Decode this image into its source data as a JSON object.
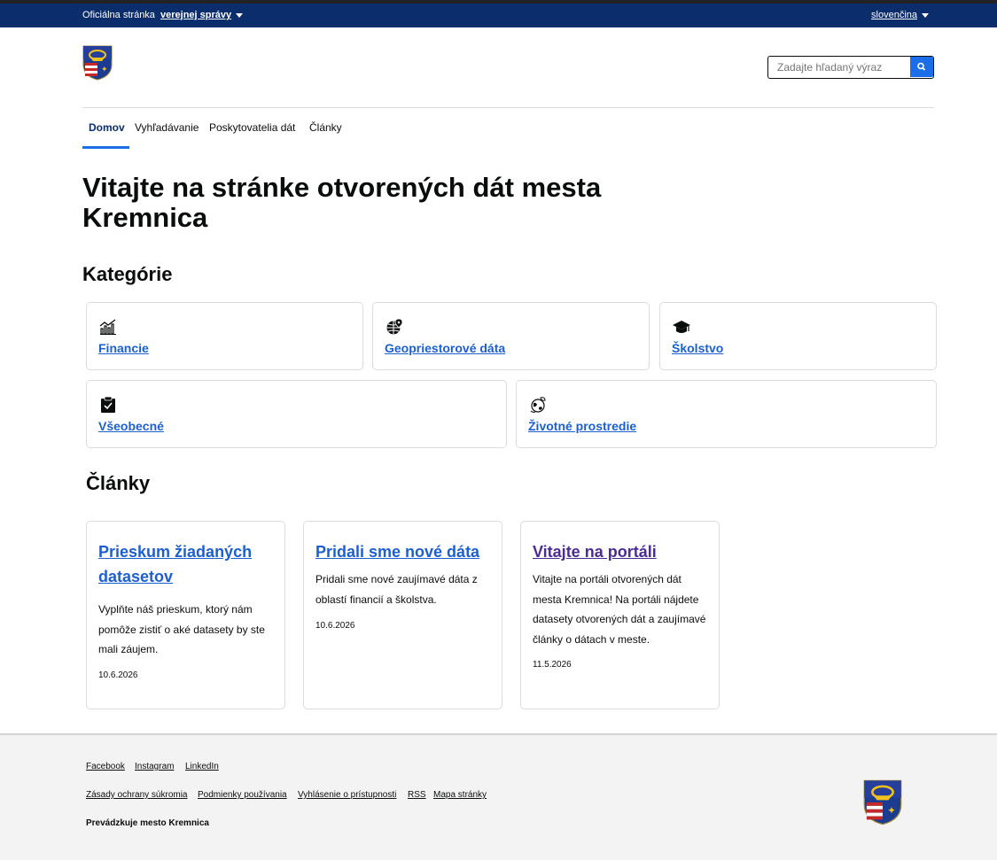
{
  "topbar": {
    "official_prefix": "Oficiálna stránka",
    "official_link": "verejnej správy",
    "language": "slovenčina"
  },
  "header": {
    "logo": "kremnica-coat-of-arms",
    "search_placeholder": "Zadajte hľadaný výraz",
    "search_icon": "search-icon",
    "nav": [
      "Domov",
      "Vyhľadávanie",
      "Poskytovatelia dát",
      "Články"
    ],
    "active_nav": "Domov"
  },
  "main": {
    "title": "Vitajte na stránke otvorených dát mesta Kremnica",
    "categories_heading": "Kategórie",
    "categories": [
      {
        "label": "Financie",
        "icon": "finance-chart-icon"
      },
      {
        "label": "Geopriestorové dáta",
        "icon": "globe-pin-icon"
      },
      {
        "label": "Školstvo",
        "icon": "graduation-cap-icon"
      },
      {
        "label": "Všeobecné",
        "icon": "clipboard-check-icon"
      },
      {
        "label": "Životné prostredie",
        "icon": "eco-globe-icon"
      }
    ],
    "articles_heading": "Články",
    "articles": [
      {
        "title": "Prieskum žiadaných datasetov",
        "body": "Vyplňte náš prieskum, ktorý nám pomôže zistiť o aké datasety by ste mali záujem.",
        "date": "10.6.2026"
      },
      {
        "title": "Pridali sme nové dáta",
        "body": "Pridali sme nové zaujímavé dáta z oblastí financií a školstva.",
        "date": "10.6.2026"
      },
      {
        "title": "Vitajte na portáli",
        "body": "Vitajte na portáli otvorených dát mesta Kremnica! Na portáli nájdete datasety otvorených dát a zaujímavé články o dátach v meste.",
        "date": "11.5.2026"
      }
    ]
  },
  "footer": {
    "social": [
      "Facebook",
      "Instagram",
      "LinkedIn"
    ],
    "links": [
      "Zásady ochrany súkromia",
      "Podmienky používania",
      "Vyhlásenie o prístupnosti",
      "RSS",
      "Mapa stránky"
    ],
    "operator": "Prevádzkuje mesto Kremnica"
  },
  "colors": {
    "topbar": "#0b2d6b",
    "link": "#1d5fcf",
    "visited_link": "#4c2c92",
    "accent": "#1c6ee8"
  }
}
